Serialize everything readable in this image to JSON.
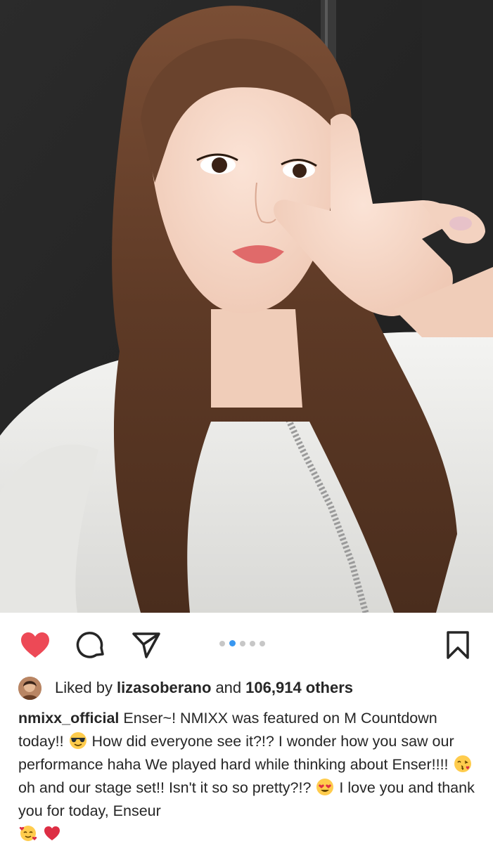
{
  "post": {
    "username": "nmixx_official",
    "photo_alt": "selfie photo",
    "carousel": {
      "total": 5,
      "active_index": 1
    }
  },
  "actions": {
    "like_icon": "heart-icon",
    "liked": true,
    "like_color": "#ed4956",
    "comment_icon": "comment-icon",
    "share_icon": "paper-plane-icon",
    "save_icon": "bookmark-icon",
    "active_dot_color": "#3897f0"
  },
  "likes": {
    "prefix": "Liked by",
    "liker": "lizasoberano",
    "connector": "and",
    "count_text": "106,914 others"
  },
  "caption": {
    "username": "nmixx_official",
    "text_1": "Enser~! NMIXX was featured on M Countdown today!!",
    "emoji_1": "😎",
    "text_2": "How did everyone see it?!? I wonder how you saw our performance haha We played hard while thinking about Enser!!!!",
    "emoji_2": "😘",
    "text_3": "oh and our stage set!! Isn't it so so pretty?!?",
    "emoji_3": "😍",
    "text_4": "I love you and thank you for today, Enseur",
    "emoji_4": "🥰",
    "emoji_5": "❤️"
  }
}
